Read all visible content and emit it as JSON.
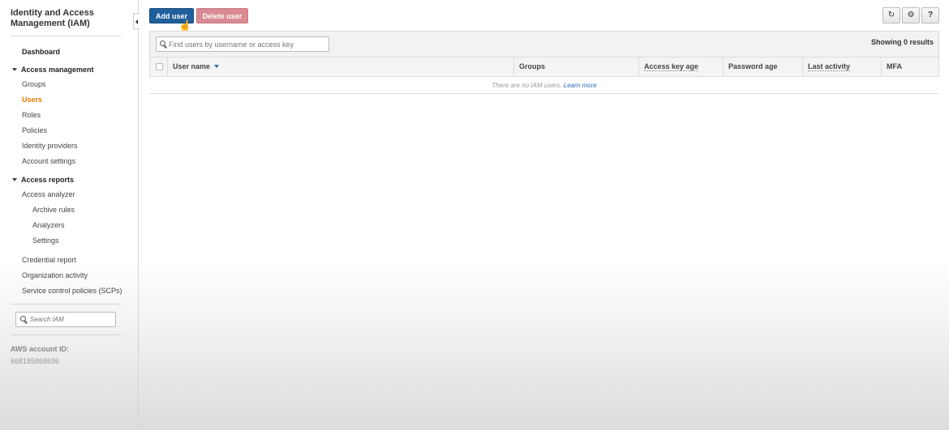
{
  "sidebar": {
    "title": "Identity and Access Management (IAM)",
    "dashboard": "Dashboard",
    "access_management": {
      "label": "Access management",
      "items": [
        "Groups",
        "Users",
        "Roles",
        "Policies",
        "Identity providers",
        "Account settings"
      ]
    },
    "access_reports": {
      "label": "Access reports",
      "analyzer": "Access analyzer",
      "analyzer_items": [
        "Archive rules",
        "Analyzers",
        "Settings"
      ],
      "items": [
        "Credential report",
        "Organization activity",
        "Service control policies (SCPs)"
      ]
    },
    "search_placeholder": "Search IAM",
    "account_label": "AWS account ID:",
    "account_id": "668185868696",
    "active_item": "Users"
  },
  "toolbar": {
    "add_user": "Add user",
    "delete_user": "Delete user",
    "refresh_icon": "refresh-icon",
    "settings_icon": "gear-icon",
    "help_icon": "help-icon"
  },
  "users_table": {
    "search_placeholder": "Find users by username or access key",
    "results": "Showing 0 results",
    "columns": [
      "User name",
      "Groups",
      "Access key age",
      "Password age",
      "Last activity",
      "MFA"
    ],
    "empty_text": "There are no IAM users.",
    "learn_more": "Learn more"
  },
  "colors": {
    "primary_button": "#1f5f9c",
    "danger_button_disabled": "#d98a92",
    "active_nav": "#e07b00",
    "link": "#2a6ab5"
  }
}
